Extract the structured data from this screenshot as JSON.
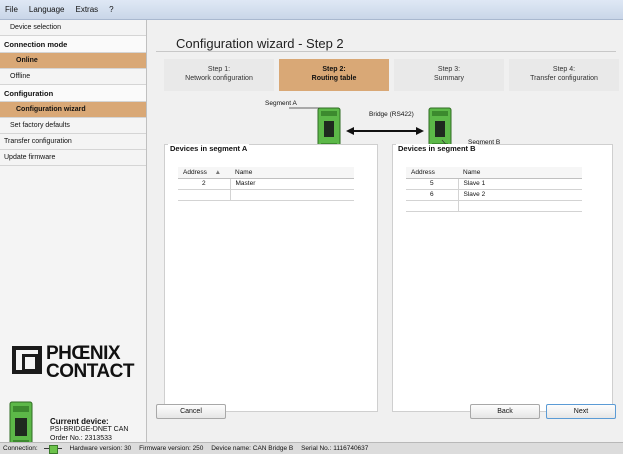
{
  "menu": {
    "file": "File",
    "language": "Language",
    "extras": "Extras",
    "help": "?"
  },
  "sidebar": {
    "device_selection": "Device selection",
    "connection_mode": "Connection mode",
    "online": "Online",
    "offline": "Offline",
    "configuration": "Configuration",
    "configuration_wizard": "Configuration wizard",
    "set_factory_defaults": "Set factory defaults",
    "transfer_configuration": "Transfer configuration",
    "update_firmware": "Update firmware"
  },
  "logo": {
    "line1": "PHŒNIX",
    "line2": "CONTACT"
  },
  "current_device": {
    "heading": "Current device:",
    "name": "PSI-BRIDGE-DNET CAN",
    "order": "Order No.:  2313533"
  },
  "wizard": {
    "title": "Configuration wizard - Step 2",
    "steps": [
      {
        "line1": "Step 1:",
        "line2": "Network configuration"
      },
      {
        "line1": "Step 2:",
        "line2": "Routing table"
      },
      {
        "line1": "Step 3:",
        "line2": "Summary"
      },
      {
        "line1": "Step 4:",
        "line2": "Transfer configuration"
      }
    ],
    "segment_a_label": "Segment A",
    "segment_b_label": "Segment B",
    "bridge_label": "Bridge (RS422)"
  },
  "segment_a": {
    "title": "Devices in segment A",
    "columns": [
      "Address",
      "Name"
    ],
    "rows": [
      {
        "address": "2",
        "name": "Master"
      }
    ]
  },
  "segment_b": {
    "title": "Devices in segment B",
    "columns": [
      "Address",
      "Name"
    ],
    "rows": [
      {
        "address": "5",
        "name": "Slave 1"
      },
      {
        "address": "6",
        "name": "Slave 2"
      }
    ]
  },
  "buttons": {
    "cancel": "Cancel",
    "back": "Back",
    "next": "Next"
  },
  "status": {
    "connection": "Connection:",
    "hardware": "Hardware version:  30",
    "firmware": "Firmware version:  250",
    "device_name": "Device name:  CAN Bridge B",
    "serial": "Serial No.:  1116740637"
  },
  "colors": {
    "accent": "#d9a876",
    "device_green": "#5cb848",
    "connection_ok": "#6cc24a"
  }
}
